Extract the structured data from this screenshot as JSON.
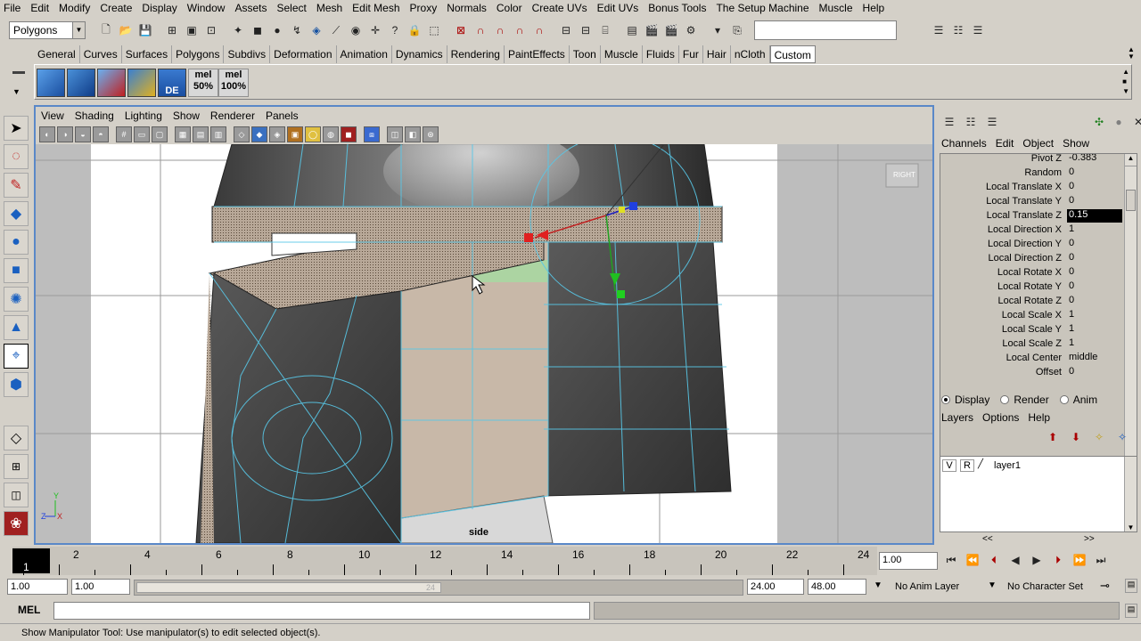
{
  "menubar": {
    "items": [
      "File",
      "Edit",
      "Modify",
      "Create",
      "Display",
      "Window",
      "Assets",
      "Select",
      "Mesh",
      "Edit Mesh",
      "Proxy",
      "Normals",
      "Color",
      "Create UVs",
      "Edit UVs",
      "Bonus Tools",
      "The Setup Machine",
      "Muscle",
      "Help"
    ]
  },
  "statusline": {
    "menuset": "Polygons"
  },
  "shelf": {
    "tabs": [
      "General",
      "Curves",
      "Surfaces",
      "Polygons",
      "Subdivs",
      "Deformation",
      "Animation",
      "Dynamics",
      "Rendering",
      "PaintEffects",
      "Toon",
      "Muscle",
      "Fluids",
      "Fur",
      "Hair",
      "nCloth",
      "Custom"
    ],
    "active_tab": "Custom",
    "mel1_top": "mel",
    "mel1_bottom": "50%",
    "mel2_top": "mel",
    "mel2_bottom": "100%",
    "de_label": "DE"
  },
  "panel": {
    "menu": [
      "View",
      "Shading",
      "Lighting",
      "Show",
      "Renderer",
      "Panels"
    ],
    "camera_label": "side",
    "view_cube_label": "RIGHT"
  },
  "channelbox": {
    "menu": [
      "Channels",
      "Edit",
      "Object",
      "Show"
    ],
    "rows": [
      {
        "label": "Pivot Z",
        "value": "-0.383"
      },
      {
        "label": "Random",
        "value": "0"
      },
      {
        "label": "Local Translate X",
        "value": "0"
      },
      {
        "label": "Local Translate Y",
        "value": "0"
      },
      {
        "label": "Local Translate Z",
        "value": "0.15"
      },
      {
        "label": "Local Direction X",
        "value": "1"
      },
      {
        "label": "Local Direction Y",
        "value": "0"
      },
      {
        "label": "Local Direction Z",
        "value": "0"
      },
      {
        "label": "Local Rotate X",
        "value": "0"
      },
      {
        "label": "Local Rotate Y",
        "value": "0"
      },
      {
        "label": "Local Rotate Z",
        "value": "0"
      },
      {
        "label": "Local Scale X",
        "value": "1"
      },
      {
        "label": "Local Scale Y",
        "value": "1"
      },
      {
        "label": "Local Scale Z",
        "value": "1"
      },
      {
        "label": "Local Center",
        "value": "middle"
      },
      {
        "label": "Offset",
        "value": "0"
      }
    ],
    "selected_row": 4
  },
  "layers": {
    "modes": [
      "Display",
      "Render",
      "Anim"
    ],
    "active_mode": "Display",
    "menu": [
      "Layers",
      "Options",
      "Help"
    ],
    "layer": {
      "v": "V",
      "r": "R",
      "name": "layer1"
    },
    "nav_left": "<<",
    "nav_right": ">>"
  },
  "timeslider": {
    "current_frame": "1",
    "labels": [
      "2",
      "4",
      "6",
      "8",
      "10",
      "12",
      "14",
      "16",
      "18",
      "20",
      "22",
      "24"
    ],
    "current_time_field": "1.00"
  },
  "range": {
    "start": "1.00",
    "playback_start": "1.00",
    "playback_end": "24.00",
    "end": "48.00",
    "slider_end_label": "24",
    "anim_layer": "No Anim Layer",
    "character_set": "No Character Set"
  },
  "cmdline": {
    "label": "MEL",
    "value": ""
  },
  "helpline": {
    "text": "Show Manipulator Tool: Use manipulator(s) to edit selected object(s)."
  }
}
